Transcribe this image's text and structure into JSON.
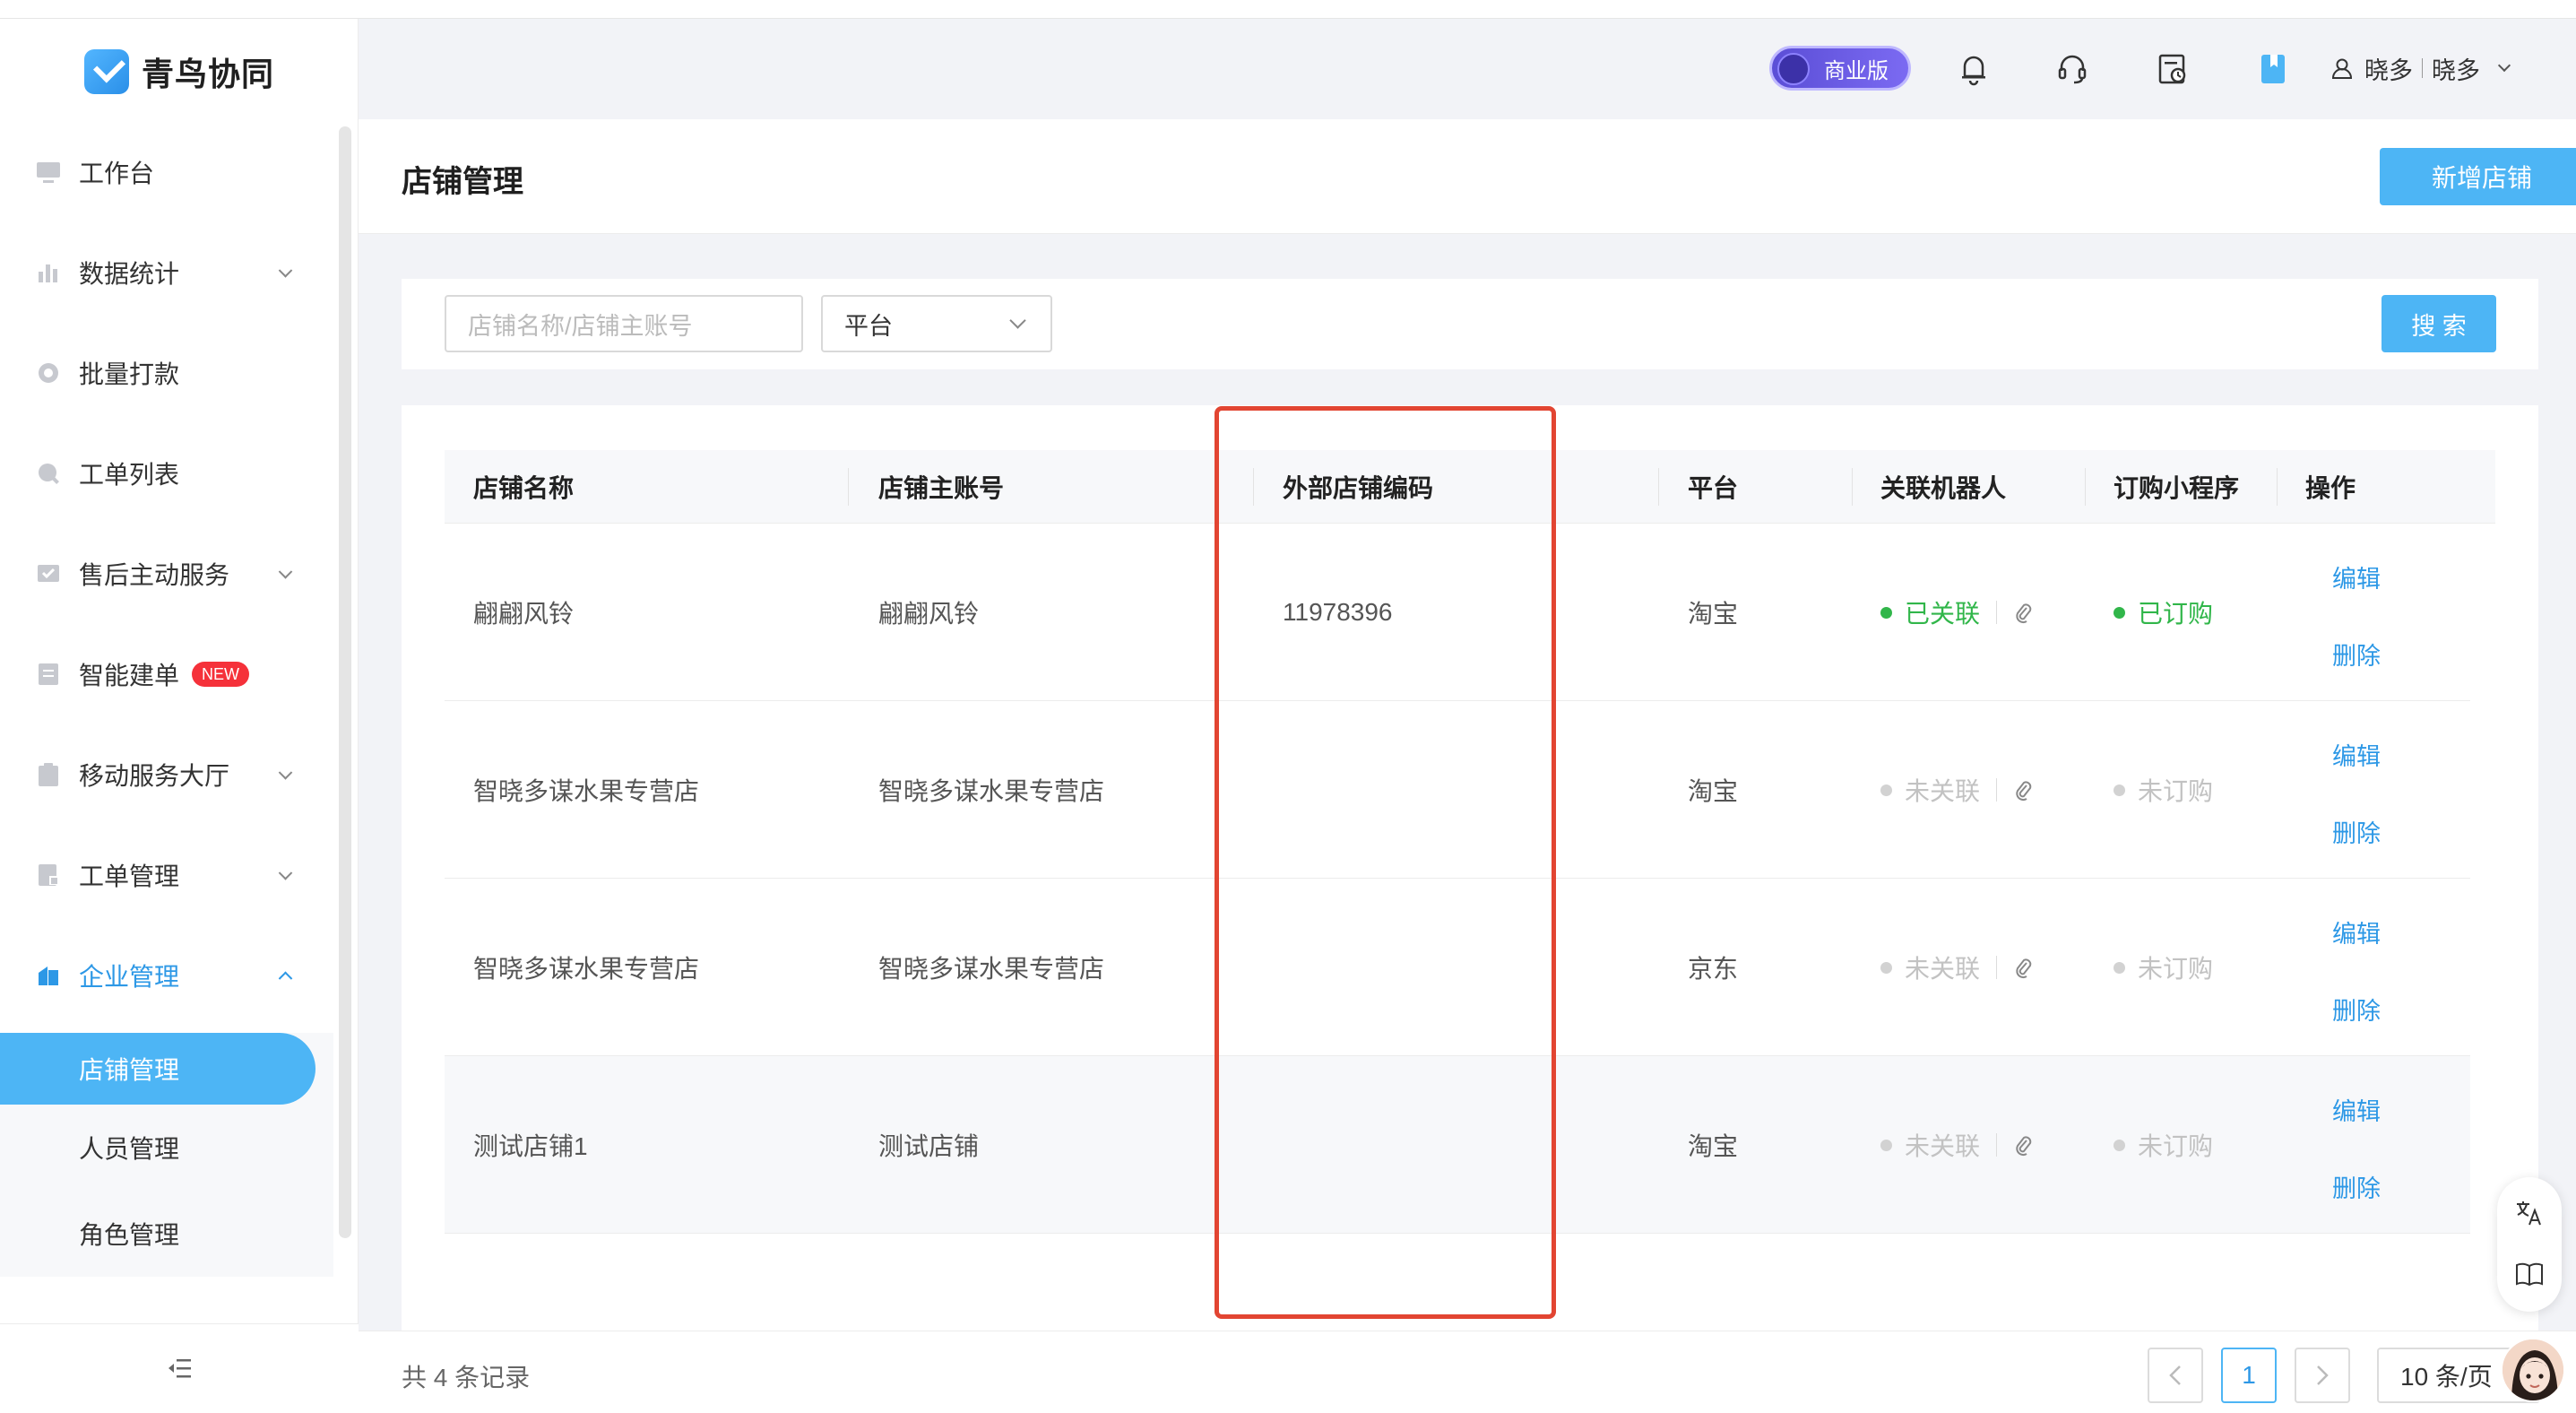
{
  "app": {
    "name": "青鸟协同"
  },
  "header": {
    "edition": "商业版",
    "user_name": "晓多",
    "user_org": "晓多"
  },
  "sidebar": {
    "items": [
      {
        "label": "工作台"
      },
      {
        "label": "数据统计"
      },
      {
        "label": "批量打款"
      },
      {
        "label": "工单列表"
      },
      {
        "label": "售后主动服务"
      },
      {
        "label": "智能建单",
        "badge": "NEW"
      },
      {
        "label": "移动服务大厅"
      },
      {
        "label": "工单管理"
      },
      {
        "label": "企业管理"
      }
    ],
    "sub_items": [
      {
        "label": "店铺管理"
      },
      {
        "label": "人员管理"
      },
      {
        "label": "角色管理"
      }
    ]
  },
  "page": {
    "title": "店铺管理",
    "add_button": "新增店铺"
  },
  "filter": {
    "search_placeholder": "店铺名称/店铺主账号",
    "platform_select": "平台",
    "search_button": "搜 索"
  },
  "table": {
    "columns": [
      "店铺名称",
      "店铺主账号",
      "外部店铺编码",
      "平台",
      "关联机器人",
      "订购小程序",
      "操作"
    ],
    "rows": [
      {
        "name": "翩翩风铃",
        "account": "翩翩风铃",
        "ext_code": "11978396",
        "platform": "淘宝",
        "robot": "已关联",
        "mini": "已订购",
        "edit": "编辑",
        "delete": "删除"
      },
      {
        "name": "智晓多谋水果专营店",
        "account": "智晓多谋水果专营店",
        "ext_code": "",
        "platform": "淘宝",
        "robot": "未关联",
        "mini": "未订购",
        "edit": "编辑",
        "delete": "删除"
      },
      {
        "name": "智晓多谋水果专营店",
        "account": "智晓多谋水果专营店",
        "ext_code": "",
        "platform": "京东",
        "robot": "未关联",
        "mini": "未订购",
        "edit": "编辑",
        "delete": "删除"
      },
      {
        "name": "测试店铺1",
        "account": "测试店铺",
        "ext_code": "",
        "platform": "淘宝",
        "robot": "未关联",
        "mini": "未订购",
        "edit": "编辑",
        "delete": "删除"
      }
    ]
  },
  "footer": {
    "total": "共 4 条记录",
    "current_page": "1",
    "page_size": "10 条/页"
  },
  "colors": {
    "accent": "#4db5f5",
    "link": "#2d98e6",
    "success": "#31b64a",
    "highlight": "#e24532"
  }
}
